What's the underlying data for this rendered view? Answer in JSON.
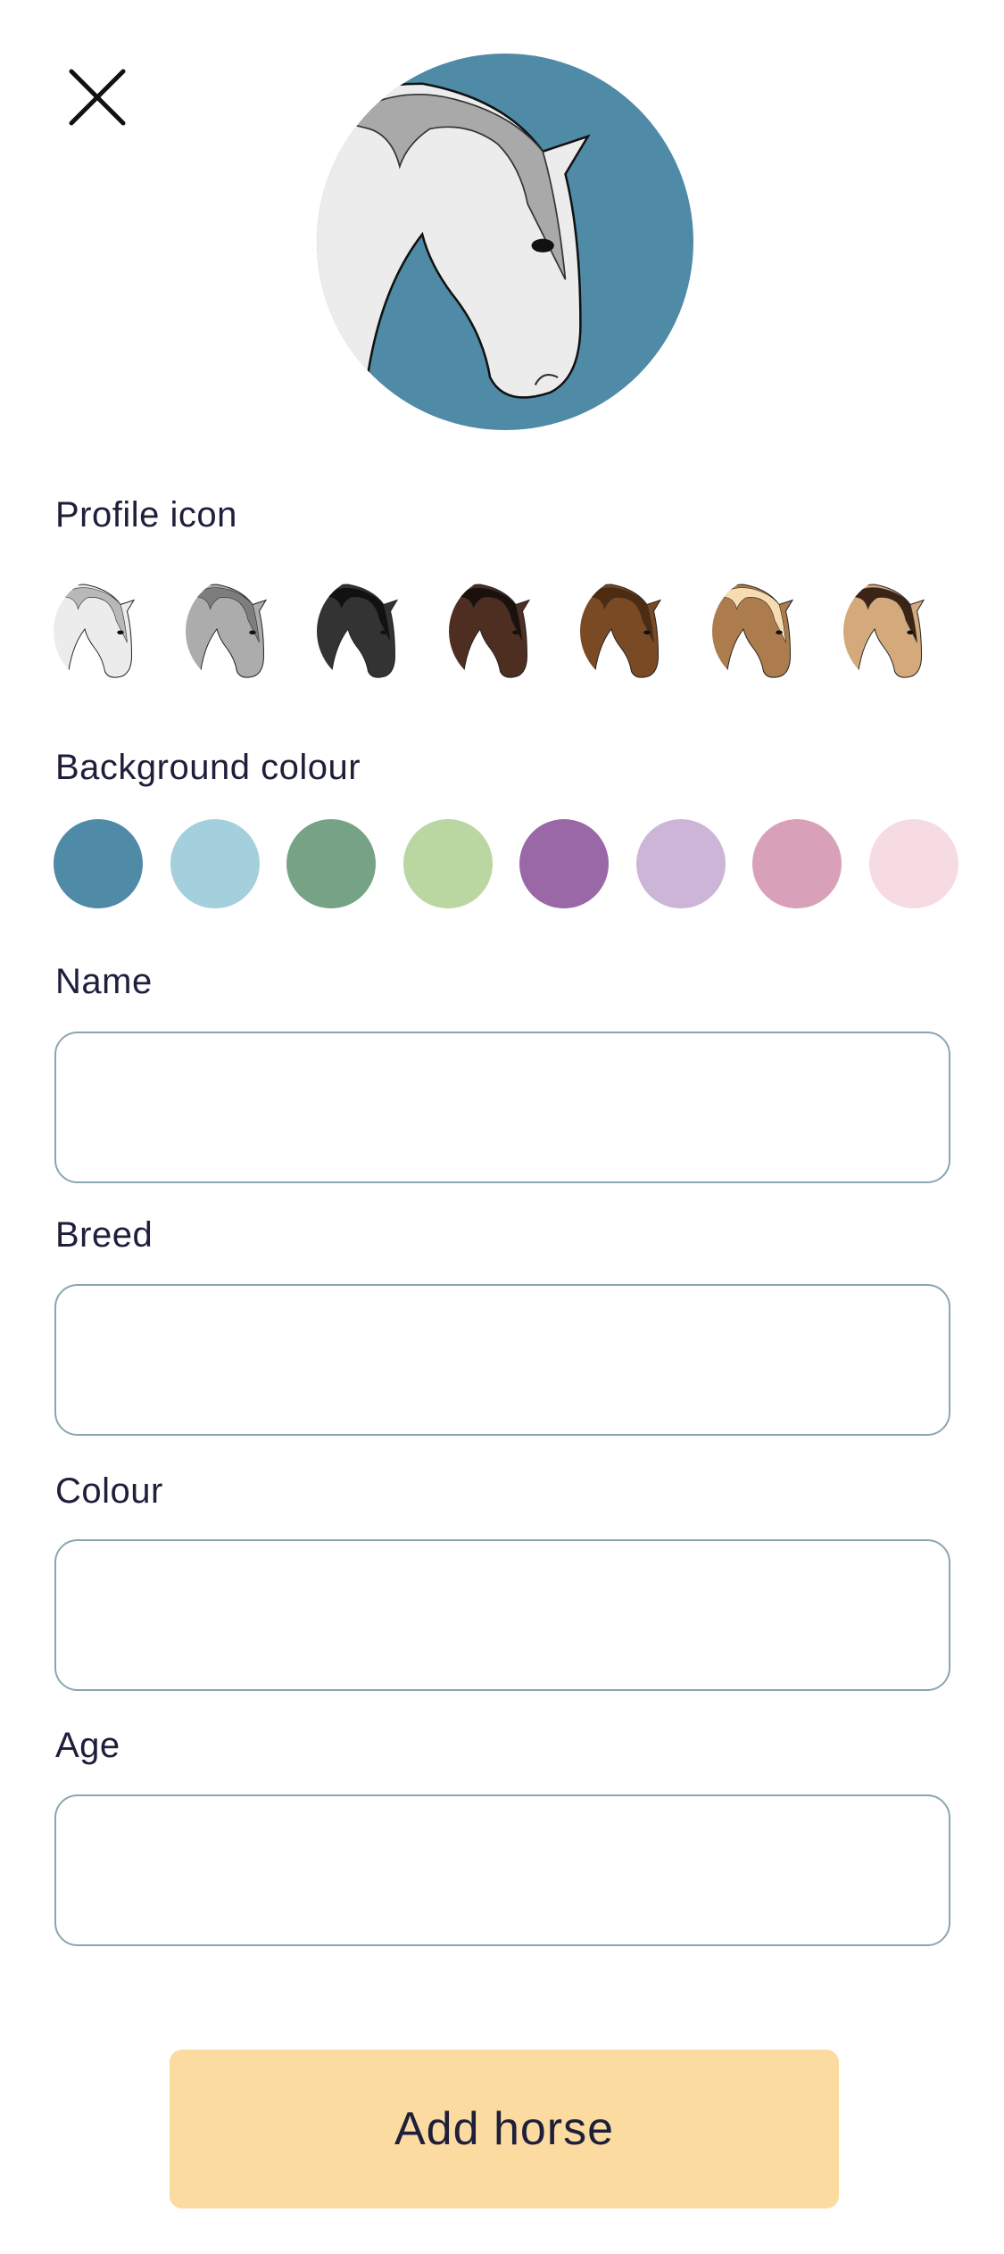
{
  "header": {
    "close_icon": "close-icon"
  },
  "preview": {
    "background_color": "#4f8aa6",
    "horse_color": "#ececec",
    "mane_color": "#a9a9a9"
  },
  "profile_icon": {
    "label": "Profile icon",
    "options": [
      {
        "name": "white",
        "coat": "#ececec",
        "mane": "#b8b8b8"
      },
      {
        "name": "grey",
        "coat": "#acacac",
        "mane": "#7d7d7d"
      },
      {
        "name": "black",
        "coat": "#333333",
        "mane": "#111111"
      },
      {
        "name": "dark-brown",
        "coat": "#4f2e22",
        "mane": "#1c100c"
      },
      {
        "name": "chestnut",
        "coat": "#7a4a24",
        "mane": "#4d2c12"
      },
      {
        "name": "palomino",
        "coat": "#ad7c4c",
        "mane": "#f6dcb0"
      },
      {
        "name": "buckskin",
        "coat": "#d4a97b",
        "mane": "#3a2416"
      }
    ]
  },
  "background_colour": {
    "label": "Background colour",
    "options": [
      "#4f8aa6",
      "#a3d0dc",
      "#76a386",
      "#bad6a1",
      "#9a67a7",
      "#cdb5d8",
      "#d9a1b9",
      "#f6dce2"
    ]
  },
  "form": {
    "name_label": "Name",
    "breed_label": "Breed",
    "colour_label": "Colour",
    "age_label": "Age",
    "name_value": "",
    "breed_value": "",
    "colour_value": "",
    "age_value": ""
  },
  "submit_label": "Add horse"
}
